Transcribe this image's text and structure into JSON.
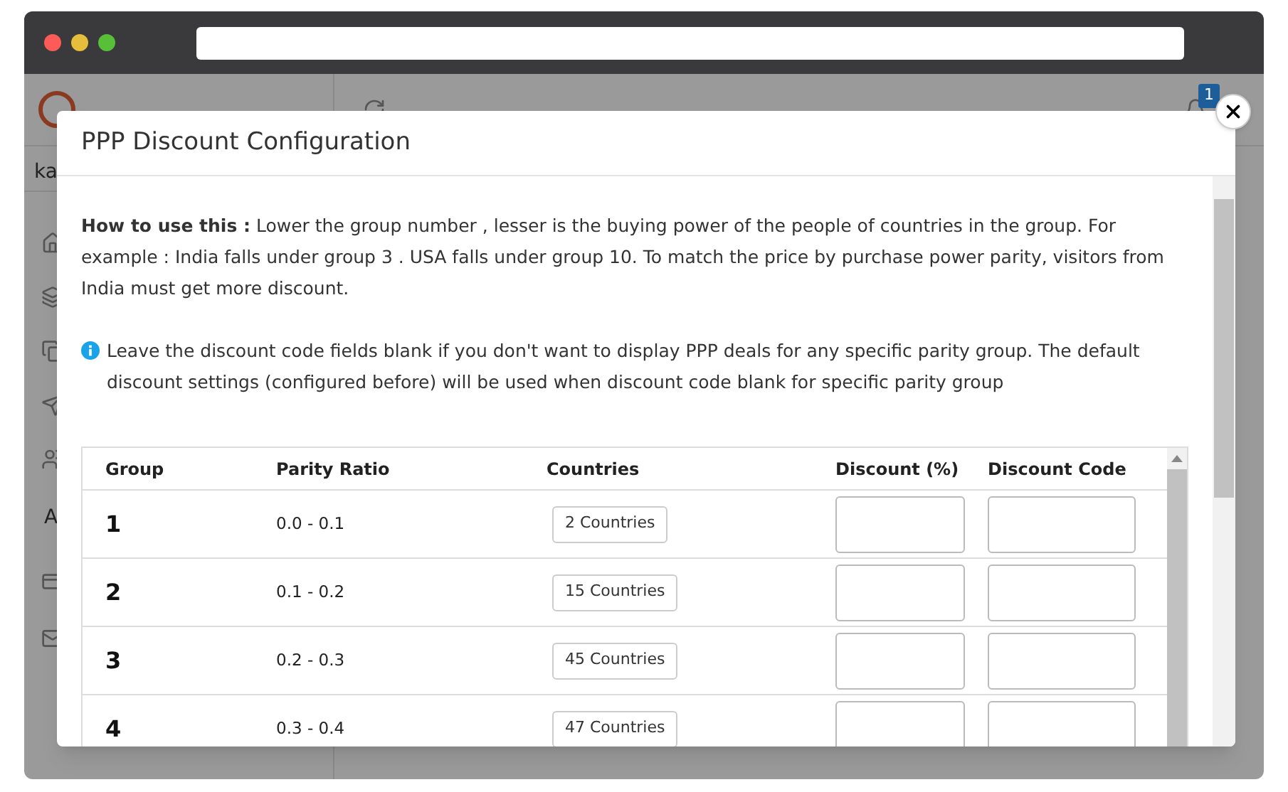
{
  "background_app": {
    "account_text": "ka",
    "sidebar_label": "A",
    "notification_count": "1"
  },
  "modal": {
    "title": "PPP Discount Configuration",
    "usage_note": "**How to use this :** Lower the group number , lesser is the buying power of the people of countries in the group. For example : India falls under group 3 . USA falls under group 10. To match the price by purchase power parity, visitors from India must get more discount.",
    "info_note": "Leave the discount code fields blank if you don't want to display PPP deals for any specific parity group. The default discount settings (configured before) will be used when discount code blank for specific parity group",
    "table": {
      "columns": [
        "Group",
        "Parity Ratio",
        "Countries",
        "Discount (%)",
        "Discount Code"
      ],
      "rows": [
        {
          "group": "1",
          "parity_ratio": "0.0 - 0.1",
          "countries": "2 Countries"
        },
        {
          "group": "2",
          "parity_ratio": "0.1 - 0.2",
          "countries": "15 Countries"
        },
        {
          "group": "3",
          "parity_ratio": "0.2 - 0.3",
          "countries": "45 Countries"
        },
        {
          "group": "4",
          "parity_ratio": "0.3 - 0.4",
          "countries": "47 Countries"
        }
      ]
    }
  }
}
